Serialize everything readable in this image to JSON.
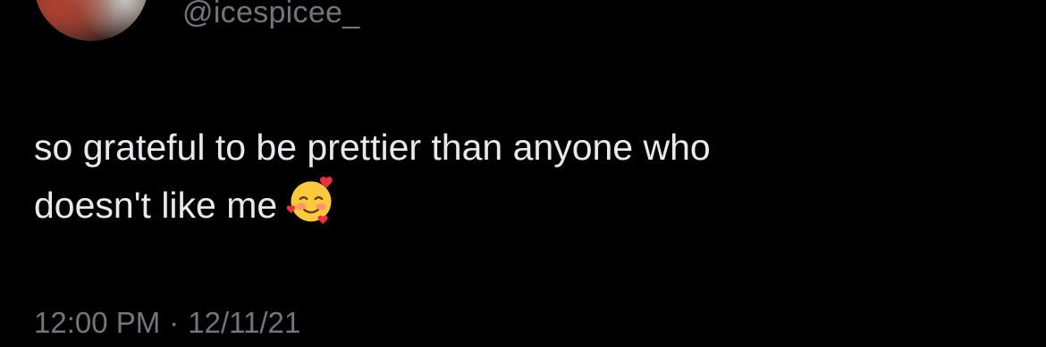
{
  "author": {
    "handle": "@icespicee_"
  },
  "tweet": {
    "line1": "so grateful to be prettier than anyone who",
    "line2": "doesn't like me",
    "emoji_name": "smiling-face-with-hearts"
  },
  "meta": {
    "time": "12:00 PM",
    "separator": "·",
    "date": "12/11/21"
  },
  "colors": {
    "background": "#000000",
    "text": "#e7e9ea",
    "muted": "#71767b"
  }
}
